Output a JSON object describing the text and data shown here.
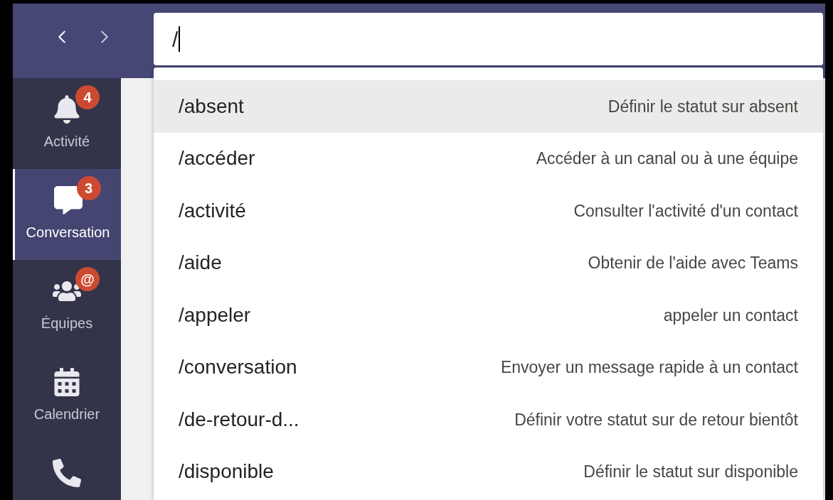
{
  "search": {
    "value": "/"
  },
  "sidebar": {
    "items": [
      {
        "kind": "activity",
        "label": "Activité",
        "badge": "4",
        "selected": false
      },
      {
        "kind": "chat",
        "label": "Conversation",
        "badge": "3",
        "selected": true
      },
      {
        "kind": "teams",
        "label": "Équipes",
        "badge": "@",
        "selected": false
      },
      {
        "kind": "calendar",
        "label": "Calendrier",
        "selected": false
      },
      {
        "kind": "calls",
        "selected": false
      }
    ]
  },
  "commands": [
    {
      "command": "/absent",
      "description": "Définir le statut sur absent",
      "selected": true
    },
    {
      "command": "/accéder",
      "description": "Accéder à un canal ou à une équipe",
      "selected": false
    },
    {
      "command": "/activité",
      "description": "Consulter l'activité d'un contact",
      "selected": false
    },
    {
      "command": "/aide",
      "description": "Obtenir de l'aide avec Teams",
      "selected": false
    },
    {
      "command": "/appeler",
      "description": "appeler un contact",
      "selected": false
    },
    {
      "command": "/conversation",
      "description": "Envoyer un message rapide à un contact",
      "selected": false
    },
    {
      "command": "/de-retour-d...",
      "description": "Définir votre statut sur de retour bientôt",
      "selected": false
    },
    {
      "command": "/disponible",
      "description": "Définir le statut sur disponible",
      "selected": false
    }
  ]
}
